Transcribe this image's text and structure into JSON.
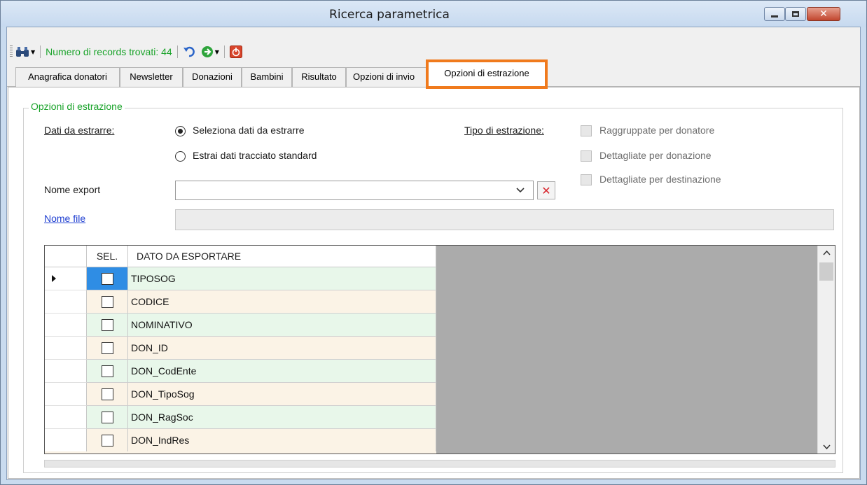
{
  "window": {
    "title": "Ricerca parametrica"
  },
  "toolbar": {
    "records_label": "Numero di records trovati: 44"
  },
  "tabs": [
    {
      "label": "Anagrafica donatori"
    },
    {
      "label": "Newsletter"
    },
    {
      "label": "Donazioni"
    },
    {
      "label": "Bambini"
    },
    {
      "label": "Risultato"
    },
    {
      "label": "Opzioni di invio"
    },
    {
      "label": "Opzioni di estrazione"
    }
  ],
  "group": {
    "title": "Opzioni di estrazione"
  },
  "form": {
    "dati_label": "Dati da estrarre:",
    "radio_seleziona": "Seleziona dati da estrarre",
    "radio_estrai": "Estrai dati tracciato standard",
    "selected_radio": "Seleziona dati da estrarre",
    "tipo_label": "Tipo di estrazione:",
    "check_raggruppate": "Raggruppate per donatore",
    "check_dettagliate_donazione": "Dettagliate per donazione",
    "check_dettagliate_destinazione": "Dettagliate per destinazione",
    "nome_export_label": "Nome export",
    "nome_export_value": "",
    "nome_file_link": "Nome file",
    "nome_file_value": ""
  },
  "grid": {
    "col_sel": "SEL.",
    "col_dato": "DATO DA ESPORTARE",
    "rows": [
      {
        "name": "TIPOSOG",
        "checked": false
      },
      {
        "name": "CODICE",
        "checked": false
      },
      {
        "name": "NOMINATIVO",
        "checked": false
      },
      {
        "name": "DON_ID",
        "checked": false
      },
      {
        "name": "DON_CodEnte",
        "checked": false
      },
      {
        "name": "DON_TipoSog",
        "checked": false
      },
      {
        "name": "DON_RagSoc",
        "checked": false
      },
      {
        "name": "DON_IndRes",
        "checked": false
      }
    ]
  },
  "colors": {
    "accent_green": "#1aa32a",
    "highlight_orange": "#f07a1d",
    "row_green": "#e8f7ea",
    "row_beige": "#fbf3e6",
    "selected_cell": "#2f8de4"
  }
}
